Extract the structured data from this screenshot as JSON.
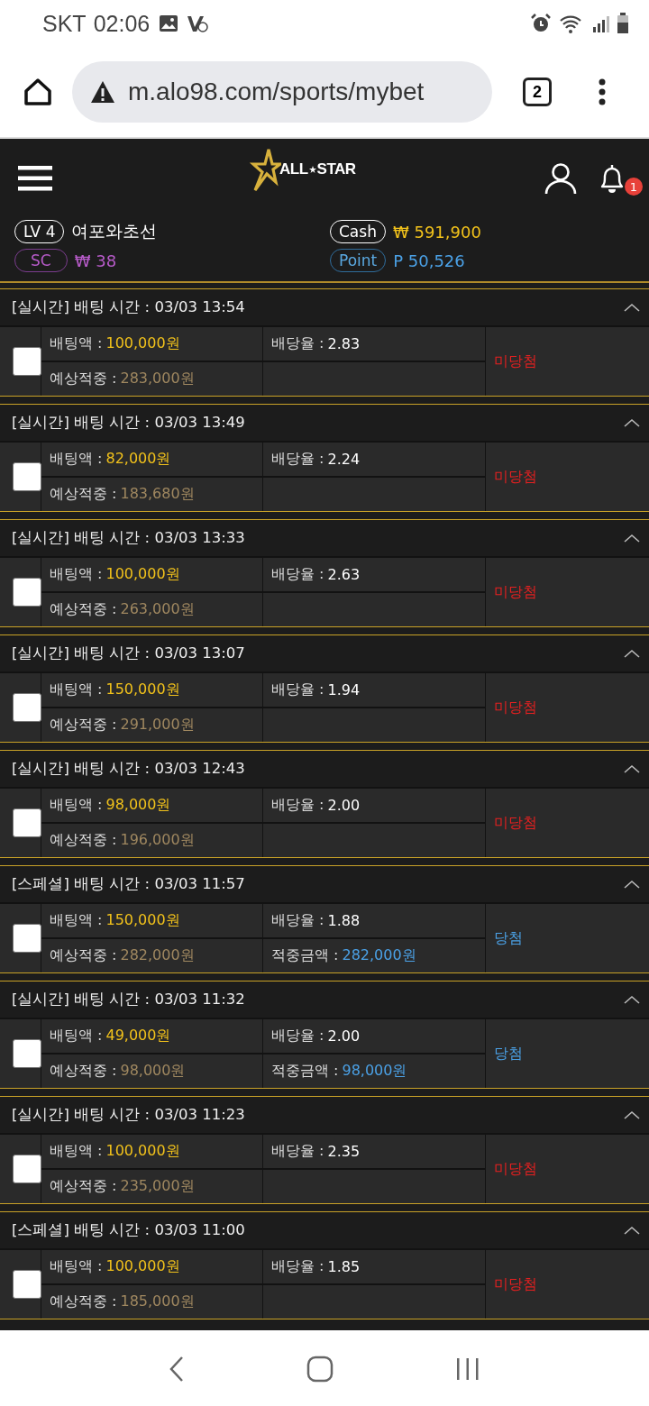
{
  "status_bar": {
    "carrier": "SKT",
    "time": "02:06"
  },
  "browser": {
    "url": "m.alo98.com/sports/mybet",
    "tab_count": "2"
  },
  "header": {
    "logo_left": "ALL",
    "logo_right": "STAR",
    "notification_count": "1"
  },
  "user": {
    "level": "LV 4",
    "name": "여포와초선",
    "cash_label": "Cash",
    "cash": "₩ 591,900",
    "sc_label": "SC",
    "sc": "₩ 38",
    "point_label": "Point",
    "point": "P 50,526"
  },
  "bets": [
    {
      "title": "[실시간] 배팅 시간 : 03/03 13:54",
      "checked": false,
      "stake_label": "배팅액 :",
      "stake": "100,000원",
      "odds_label": "배당율 :",
      "odds": "2.83",
      "expected_label": "예상적중 :",
      "expected": "283,000원",
      "result": {
        "kind": "lost",
        "text": "미당첨"
      }
    },
    {
      "title": "[실시간] 배팅 시간 : 03/03 13:49",
      "checked": false,
      "stake_label": "배팅액 :",
      "stake": "82,000원",
      "odds_label": "배당율 :",
      "odds": "2.24",
      "expected_label": "예상적중 :",
      "expected": "183,680원",
      "result": {
        "kind": "lost",
        "text": "미당첨"
      }
    },
    {
      "title": "[실시간] 배팅 시간 : 03/03 13:33",
      "checked": false,
      "stake_label": "배팅액 :",
      "stake": "100,000원",
      "odds_label": "배당율 :",
      "odds": "2.63",
      "expected_label": "예상적중 :",
      "expected": "263,000원",
      "result": {
        "kind": "lost",
        "text": "미당첨"
      }
    },
    {
      "title": "[실시간] 배팅 시간 : 03/03 13:07",
      "checked": false,
      "stake_label": "배팅액 :",
      "stake": "150,000원",
      "odds_label": "배당율 :",
      "odds": "1.94",
      "expected_label": "예상적중 :",
      "expected": "291,000원",
      "result": {
        "kind": "lost",
        "text": "미당첨"
      }
    },
    {
      "title": "[실시간] 배팅 시간 : 03/03 12:43",
      "checked": false,
      "stake_label": "배팅액 :",
      "stake": "98,000원",
      "odds_label": "배당율 :",
      "odds": "2.00",
      "expected_label": "예상적중 :",
      "expected": "196,000원",
      "result": {
        "kind": "lost",
        "text": "미당첨"
      }
    },
    {
      "title": "[스페셜] 배팅 시간 : 03/03 11:57",
      "checked": false,
      "stake_label": "배팅액 :",
      "stake": "150,000원",
      "odds_label": "배당율 :",
      "odds": "1.88",
      "expected_label": "예상적중 :",
      "expected": "282,000원",
      "win_label": "적중금액 :",
      "win": "282,000원",
      "result": {
        "kind": "won",
        "text": "당첨"
      }
    },
    {
      "title": "[실시간] 배팅 시간 : 03/03 11:32",
      "checked": false,
      "stake_label": "배팅액 :",
      "stake": "49,000원",
      "odds_label": "배당율 :",
      "odds": "2.00",
      "expected_label": "예상적중 :",
      "expected": "98,000원",
      "win_label": "적중금액 :",
      "win": "98,000원",
      "result": {
        "kind": "won",
        "text": "당첨"
      }
    },
    {
      "title": "[실시간] 배팅 시간 : 03/03 11:23",
      "checked": false,
      "stake_label": "배팅액 :",
      "stake": "100,000원",
      "odds_label": "배당율 :",
      "odds": "2.35",
      "expected_label": "예상적중 :",
      "expected": "235,000원",
      "result": {
        "kind": "lost",
        "text": "미당첨"
      }
    },
    {
      "title": "[스페셜] 배팅 시간 : 03/03 11:00",
      "checked": false,
      "stake_label": "배팅액 :",
      "stake": "100,000원",
      "odds_label": "배당율 :",
      "odds": "1.85",
      "expected_label": "예상적중 :",
      "expected": "185,000원",
      "result": {
        "kind": "lost",
        "text": "미당첨"
      }
    }
  ]
}
